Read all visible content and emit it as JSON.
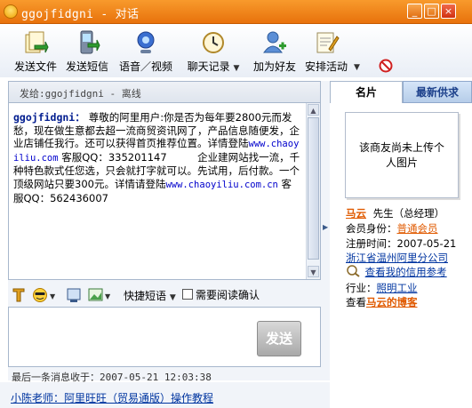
{
  "window": {
    "title": "ggojfidgni - 对话",
    "buttons": {
      "minimize": "_",
      "maximize": "□",
      "close": "×"
    }
  },
  "toolbar": {
    "items": [
      {
        "label": "发送文件",
        "icon": "send-file-icon"
      },
      {
        "label": "发送短信",
        "icon": "send-sms-icon"
      },
      {
        "label": "语音／视频",
        "icon": "voice-video-icon"
      },
      {
        "label": "聊天记录",
        "icon": "chat-history-icon"
      },
      {
        "label": "加为好友",
        "icon": "add-friend-icon"
      },
      {
        "label": "安排活动",
        "icon": "schedule-activity-icon"
      }
    ],
    "more": "▼"
  },
  "chat": {
    "header": "发给:ggojfidgni - 离线",
    "sender": "ggojfidgni：",
    "message_parts": [
      {
        "type": "text",
        "value": "尊敬的阿里用户:你是否为每年要2800元而发愁，现在做生意都去超一流商贸资讯网了，产品信息随便发，企业店铺任我行。还可以获得首页推荐位置。详情登陆"
      },
      {
        "type": "url",
        "value": "www.chaoyiliu.com"
      },
      {
        "type": "text",
        "value": " 客服QQ：335201147　　　企业建网站找一流，千种特色款式任您选，只会就打字就可以。先试用，后付款。一个顶级网站只要300元。详情请登陆"
      },
      {
        "type": "url",
        "value": "www.chaoyiliu.com.cn"
      },
      {
        "type": "text",
        "value": " 客服QQ：562436007"
      }
    ],
    "input_toolbar": {
      "quick_phrase": "快捷短语",
      "read_confirm": "需要阅读确认",
      "read_confirm_checked": false
    },
    "send_label": "发送",
    "last_message": "最后一条消息收于：2007-05-21 12:03:38"
  },
  "bottom_link": "小陈老师：阿里旺旺（贸易通版）操作教程",
  "profile": {
    "tabs": [
      "名片",
      "最新供求"
    ],
    "active_tab": 0,
    "no_photo": "该商友尚未上传个人图片",
    "name": "马云",
    "title": "先生（总经理）",
    "member_label": "会员身份：",
    "member_value": "普通会员",
    "register_label": "注册时间：",
    "register_value": "2007-05-21",
    "company": "浙江省温州阿里分公司",
    "credit_link": "查看我的信用参考",
    "industry_label": "行业：",
    "industry_value": "照明工业",
    "blog_prefix": "查看",
    "blog_link": "马云的博客"
  },
  "colors": {
    "titlebar": "#f08420",
    "link": "#0035a0",
    "accent_orange": "#e05a00",
    "tab_inactive_text": "#1b3f8a"
  }
}
